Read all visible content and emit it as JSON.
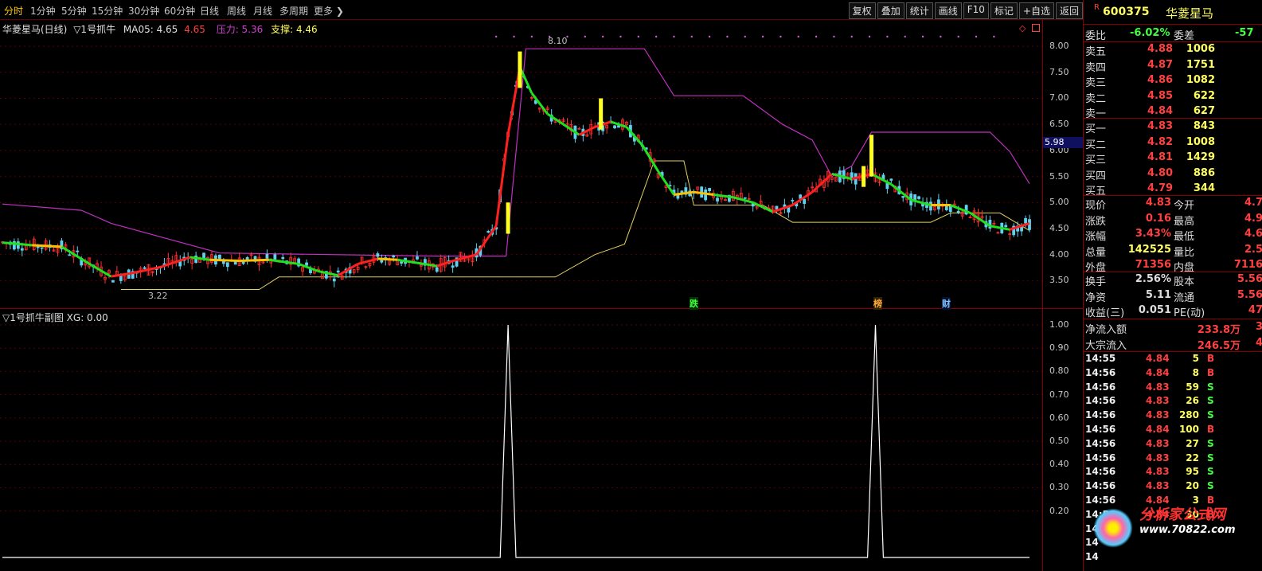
{
  "top_tabs": [
    "分时",
    "1分钟",
    "5分钟",
    "15分钟",
    "30分钟",
    "60分钟",
    "日线",
    "周线",
    "月线",
    "多周期",
    "更多"
  ],
  "top_buttons": [
    "复权",
    "叠加",
    "统计",
    "画线",
    "F10",
    "标记",
    "+自选",
    "返回"
  ],
  "main_info": {
    "name": "华菱星马(日线)",
    "indicator": "▽1号抓牛",
    "ma5_label": "MA05: 4.65",
    "ma5_val2": "4.65",
    "pressure_label": "压力: 5.36",
    "support_label": "支撑: 4.46"
  },
  "sub_info": {
    "label": "▽1号抓牛副图 XG: 0.00"
  },
  "price_annotations": {
    "high": "8.10",
    "low": "3.22",
    "current_tag": "5.98"
  },
  "event_markers": [
    "跌",
    "榜",
    "财"
  ],
  "right_panel": {
    "code": "600375",
    "name": "华菱星马",
    "r_badge": "R",
    "weibi_label": "委比",
    "weibi_val": "-6.02%",
    "weicha_label": "委差",
    "weicha_val": "-57",
    "asks": [
      {
        "label": "卖五",
        "price": "4.88",
        "vol": "1006"
      },
      {
        "label": "卖四",
        "price": "4.87",
        "vol": "1751"
      },
      {
        "label": "卖三",
        "price": "4.86",
        "vol": "1082"
      },
      {
        "label": "卖二",
        "price": "4.85",
        "vol": "622"
      },
      {
        "label": "卖一",
        "price": "4.84",
        "vol": "627"
      }
    ],
    "bids": [
      {
        "label": "买一",
        "price": "4.83",
        "vol": "843"
      },
      {
        "label": "买二",
        "price": "4.82",
        "vol": "1008"
      },
      {
        "label": "买三",
        "price": "4.81",
        "vol": "1429"
      },
      {
        "label": "买四",
        "price": "4.80",
        "vol": "886"
      },
      {
        "label": "买五",
        "price": "4.79",
        "vol": "344"
      }
    ],
    "stats": [
      {
        "l1": "现价",
        "v1": "4.83",
        "l2": "今开",
        "v2": "4.7"
      },
      {
        "l1": "涨跌",
        "v1": "0.16",
        "l2": "最高",
        "v2": "4.9"
      },
      {
        "l1": "涨幅",
        "v1": "3.43%",
        "l2": "最低",
        "v2": "4.6"
      },
      {
        "l1": "总量",
        "v1": "142525",
        "l2": "量比",
        "v2": "2.5"
      },
      {
        "l1": "外盘",
        "v1": "71356",
        "l2": "内盘",
        "v2": "7116"
      }
    ],
    "stats2": [
      {
        "l1": "换手",
        "v1": "2.56%",
        "l2": "股本",
        "v2": "5.56"
      },
      {
        "l1": "净资",
        "v1": "5.11",
        "l2": "流通",
        "v2": "5.56"
      },
      {
        "l1": "收益(三)",
        "v1": "0.051",
        "l2": "PE(动)",
        "v2": "47"
      }
    ],
    "flows": [
      {
        "l": "净流入额",
        "v": "233.8万",
        "x": "3"
      },
      {
        "l": "大宗流入",
        "v": "246.5万",
        "x": "4"
      }
    ],
    "ticks": [
      {
        "t": "14:55",
        "p": "4.84",
        "v": "5",
        "s": "B"
      },
      {
        "t": "14:56",
        "p": "4.84",
        "v": "8",
        "s": "B"
      },
      {
        "t": "14:56",
        "p": "4.83",
        "v": "59",
        "s": "S"
      },
      {
        "t": "14:56",
        "p": "4.83",
        "v": "26",
        "s": "S"
      },
      {
        "t": "14:56",
        "p": "4.83",
        "v": "280",
        "s": "S"
      },
      {
        "t": "14:56",
        "p": "4.84",
        "v": "100",
        "s": "B"
      },
      {
        "t": "14:56",
        "p": "4.83",
        "v": "27",
        "s": "S"
      },
      {
        "t": "14:56",
        "p": "4.83",
        "v": "22",
        "s": "S"
      },
      {
        "t": "14:56",
        "p": "4.83",
        "v": "95",
        "s": "S"
      },
      {
        "t": "14:56",
        "p": "4.83",
        "v": "20",
        "s": "S"
      },
      {
        "t": "14:56",
        "p": "4.84",
        "v": "3",
        "s": "B"
      },
      {
        "t": "14:56",
        "p": "4.84",
        "v": "30",
        "s": "B"
      },
      {
        "t": "14",
        "p": "",
        "v": "",
        "s": ""
      },
      {
        "t": "14",
        "p": "",
        "v": "",
        "s": ""
      },
      {
        "t": "14",
        "p": "",
        "v": "",
        "s": ""
      }
    ],
    "watermark_title": "分析家公式网",
    "watermark_url": "www.70822.com"
  },
  "chart_data": {
    "type": "candlestick",
    "main_yaxis_ticks": [
      "8.00",
      "7.50",
      "7.00",
      "6.50",
      "6.00",
      "5.50",
      "5.00",
      "4.50",
      "4.00",
      "3.50"
    ],
    "main_ylim": [
      3.2,
      8.2
    ],
    "sub_yaxis_ticks": [
      "1.00",
      "0.90",
      "0.80",
      "0.70",
      "0.60",
      "0.50",
      "0.40",
      "0.30",
      "0.20"
    ],
    "sub_ylim": [
      0,
      1.0
    ],
    "ma_line": [
      [
        0,
        4.23
      ],
      [
        15,
        4.18
      ],
      [
        30,
        4.15
      ],
      [
        45,
        3.8
      ],
      [
        55,
        3.58
      ],
      [
        65,
        3.64
      ],
      [
        80,
        3.76
      ],
      [
        95,
        3.95
      ],
      [
        105,
        3.9
      ],
      [
        120,
        3.88
      ],
      [
        135,
        3.9
      ],
      [
        150,
        3.82
      ],
      [
        160,
        3.68
      ],
      [
        170,
        3.6
      ],
      [
        180,
        3.82
      ],
      [
        190,
        3.92
      ],
      [
        200,
        3.9
      ],
      [
        210,
        3.84
      ],
      [
        220,
        3.78
      ],
      [
        230,
        3.9
      ],
      [
        240,
        4.0
      ],
      [
        250,
        4.55
      ],
      [
        256,
        6.3
      ],
      [
        262,
        7.6
      ],
      [
        268,
        7.1
      ],
      [
        276,
        6.7
      ],
      [
        284,
        6.5
      ],
      [
        292,
        6.3
      ],
      [
        300,
        6.45
      ],
      [
        308,
        6.55
      ],
      [
        316,
        6.45
      ],
      [
        324,
        6.1
      ],
      [
        332,
        5.6
      ],
      [
        340,
        5.15
      ],
      [
        350,
        5.2
      ],
      [
        360,
        5.15
      ],
      [
        370,
        5.1
      ],
      [
        380,
        5.0
      ],
      [
        390,
        4.82
      ],
      [
        400,
        4.95
      ],
      [
        410,
        5.2
      ],
      [
        420,
        5.55
      ],
      [
        430,
        5.45
      ],
      [
        440,
        5.55
      ],
      [
        450,
        5.35
      ],
      [
        460,
        5.05
      ],
      [
        470,
        4.95
      ],
      [
        480,
        4.95
      ],
      [
        490,
        4.8
      ],
      [
        500,
        4.55
      ],
      [
        510,
        4.48
      ],
      [
        520,
        4.6
      ]
    ],
    "pressure_line": [
      [
        0,
        4.97
      ],
      [
        40,
        4.85
      ],
      [
        55,
        4.6
      ],
      [
        110,
        4.03
      ],
      [
        220,
        3.97
      ],
      [
        255,
        3.97
      ],
      [
        265,
        7.95
      ],
      [
        300,
        7.95
      ],
      [
        325,
        7.95
      ],
      [
        340,
        7.05
      ],
      [
        375,
        7.05
      ],
      [
        395,
        6.5
      ],
      [
        410,
        6.2
      ],
      [
        420,
        5.5
      ],
      [
        430,
        5.7
      ],
      [
        440,
        6.35
      ],
      [
        500,
        6.35
      ],
      [
        510,
        5.98
      ],
      [
        520,
        5.36
      ]
    ],
    "support_line": [
      [
        60,
        3.33
      ],
      [
        130,
        3.33
      ],
      [
        140,
        3.57
      ],
      [
        240,
        3.57
      ],
      [
        280,
        3.57
      ],
      [
        300,
        4.0
      ],
      [
        315,
        4.2
      ],
      [
        330,
        5.8
      ],
      [
        345,
        5.8
      ],
      [
        350,
        4.95
      ],
      [
        385,
        4.95
      ],
      [
        400,
        4.62
      ],
      [
        470,
        4.62
      ],
      [
        480,
        4.8
      ],
      [
        505,
        4.8
      ],
      [
        520,
        4.46
      ]
    ],
    "xg_signals": [
      [
        0,
        0
      ],
      [
        252,
        0
      ],
      [
        256,
        1
      ],
      [
        260,
        0
      ],
      [
        438,
        0
      ],
      [
        442,
        1
      ],
      [
        446,
        0
      ],
      [
        520,
        0
      ]
    ]
  }
}
